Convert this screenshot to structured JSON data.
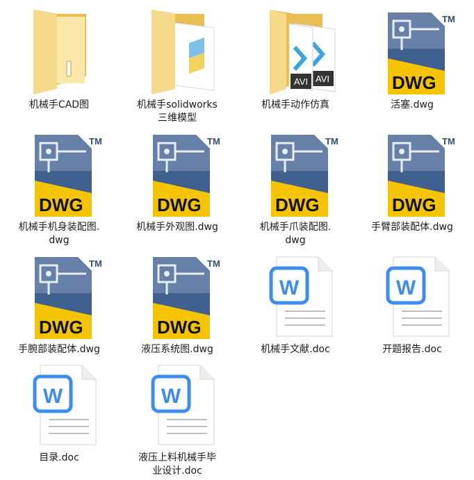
{
  "files": [
    {
      "type": "folder",
      "variant": "plain",
      "label": "机械手CAD图",
      "label2": ""
    },
    {
      "type": "folder",
      "variant": "solidworks",
      "label": "机械手solidworks",
      "label2": "三维模型"
    },
    {
      "type": "folder",
      "variant": "avi",
      "label": "机械手动作仿真",
      "label2": ""
    },
    {
      "type": "dwg",
      "label": "活塞.dwg",
      "label2": ""
    },
    {
      "type": "dwg",
      "label": "机械手机身装配图.",
      "label2": "dwg"
    },
    {
      "type": "dwg",
      "label": "机械手外观图.dwg",
      "label2": ""
    },
    {
      "type": "dwg",
      "label": "机械手爪装配图.",
      "label2": "dwg"
    },
    {
      "type": "dwg",
      "label": "手臂部装配体.dwg",
      "label2": ""
    },
    {
      "type": "dwg",
      "label": "手腕部装配体.dwg",
      "label2": ""
    },
    {
      "type": "dwg",
      "label": "液压系统图.dwg",
      "label2": ""
    },
    {
      "type": "doc",
      "label": "机械手文献.doc",
      "label2": ""
    },
    {
      "type": "doc",
      "label": "开题报告.doc",
      "label2": ""
    },
    {
      "type": "doc",
      "label": "目录.doc",
      "label2": ""
    },
    {
      "type": "doc",
      "label": "液压上料机械手毕",
      "label2": "业设计.doc"
    }
  ],
  "icon_text": {
    "dwg": "DWG",
    "tm": "TM",
    "avi": "AVI",
    "word": "W"
  },
  "colors": {
    "folder": "#f3d37e",
    "dwg_yellow": "#f5c400",
    "dwg_blue": "#3f5f8e",
    "word_blue": "#3f8cf0"
  }
}
